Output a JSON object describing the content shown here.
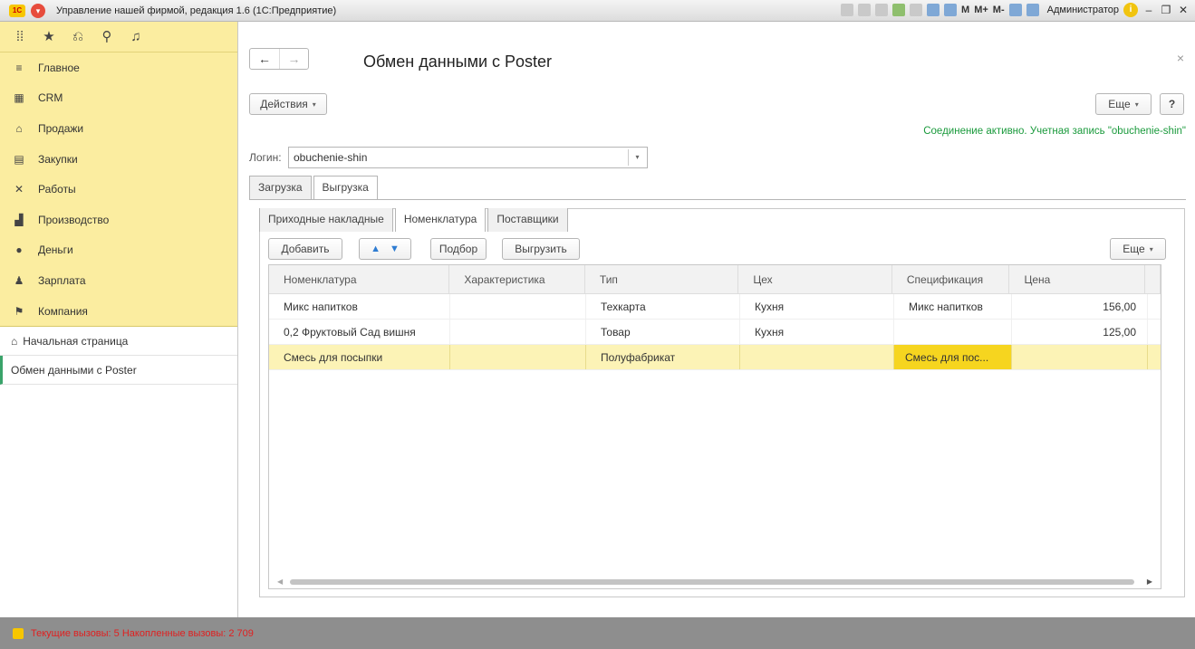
{
  "window": {
    "title": "Управление нашей фирмой, редакция 1.6 (1С:Предприятие)",
    "logo": "1С",
    "user": "Администратор",
    "m_labels": [
      "M",
      "M+",
      "M-"
    ]
  },
  "sidebar": {
    "items": [
      {
        "label": "Главное",
        "icon": "list-icon"
      },
      {
        "label": "CRM",
        "icon": "contacts-icon"
      },
      {
        "label": "Продажи",
        "icon": "cart-icon"
      },
      {
        "label": "Закупки",
        "icon": "warehouse-icon"
      },
      {
        "label": "Работы",
        "icon": "tools-icon"
      },
      {
        "label": "Производство",
        "icon": "factory-icon"
      },
      {
        "label": "Деньги",
        "icon": "money-icon"
      },
      {
        "label": "Зарплата",
        "icon": "people-icon"
      },
      {
        "label": "Компания",
        "icon": "flag-icon"
      }
    ],
    "home_label": "Начальная страница",
    "open_form_label": "Обмен данными с Poster"
  },
  "form": {
    "title": "Обмен данными с Poster",
    "actions_label": "Действия",
    "more_label": "Еще",
    "help_label": "?",
    "connection_status": "Соединение активно. Учетная запись \"obuchenie-shin\"",
    "login_label": "Логин:",
    "login_value": "obuchenie-shin",
    "tabs": [
      "Загрузка",
      "Выгрузка"
    ],
    "subtabs": [
      "Приходные накладные",
      "Номенклатура",
      "Поставщики"
    ],
    "toolbar": {
      "add": "Добавить",
      "select": "Подбор",
      "upload": "Выгрузить",
      "more": "Еще"
    },
    "columns": [
      "Номенклатура",
      "Характеристика",
      "Тип",
      "Цех",
      "Спецификация",
      "Цена"
    ],
    "rows": [
      {
        "name": "Микс напитков",
        "char": "",
        "type": "Техкарта",
        "shop": "Кухня",
        "spec": "Микс напитков",
        "price": "156,00"
      },
      {
        "name": "0,2 Фруктовый Сад вишня",
        "char": "",
        "type": "Товар",
        "shop": "Кухня",
        "spec": "",
        "price": "125,00"
      },
      {
        "name": "Смесь для посыпки",
        "char": "",
        "type": "Полуфабрикат",
        "shop": "",
        "spec": "Смесь для пос...",
        "price": ""
      }
    ]
  },
  "statusbar": {
    "text": "Текущие вызовы: 5   Накопленные вызовы: 2 709"
  }
}
